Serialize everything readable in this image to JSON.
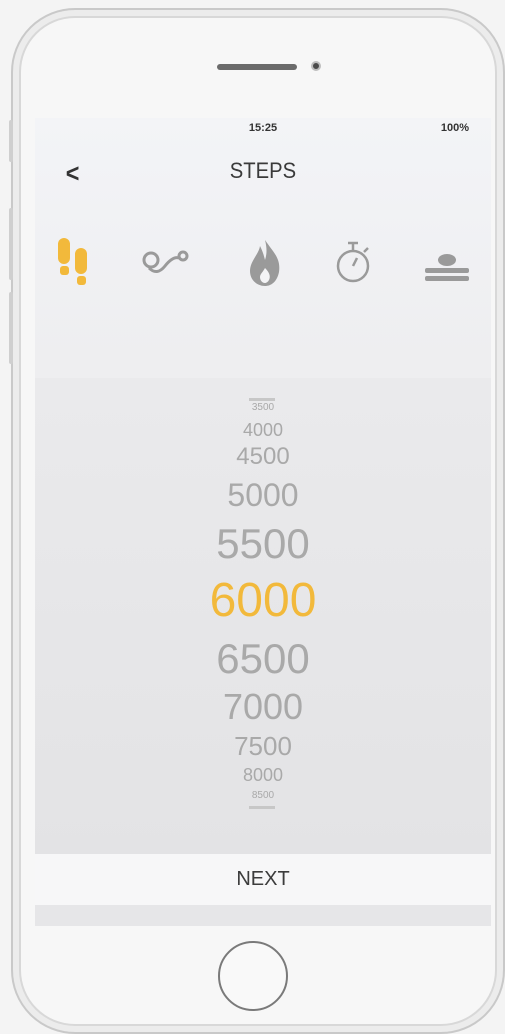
{
  "status": {
    "time": "15:25",
    "battery": "100%"
  },
  "nav": {
    "back": "<",
    "title": "STEPS"
  },
  "icons": [
    {
      "name": "steps-icon",
      "color": "#f2b93b",
      "selected": true
    },
    {
      "name": "distance-icon",
      "color": "#9a9a9a",
      "selected": false
    },
    {
      "name": "calories-icon",
      "color": "#9a9a9a",
      "selected": false
    },
    {
      "name": "timer-icon",
      "color": "#9a9a9a",
      "selected": false
    },
    {
      "name": "sleep-icon",
      "color": "#9a9a9a",
      "selected": false
    }
  ],
  "picker": {
    "values": [
      "3500",
      "4000",
      "4500",
      "5000",
      "5500",
      "6000",
      "6500",
      "7000",
      "7500",
      "8000",
      "8500"
    ],
    "selected": "6000"
  },
  "actions": {
    "next": "NEXT"
  },
  "colors": {
    "accent": "#f2b93b",
    "inactive": "#a9a9a9"
  }
}
